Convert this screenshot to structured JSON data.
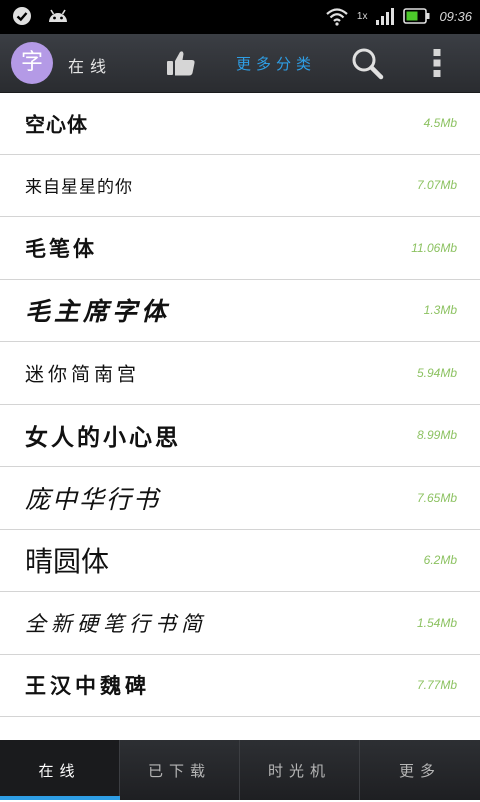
{
  "status_bar": {
    "network_label": "1x",
    "time": "09:36",
    "icons": [
      "check-circle-icon",
      "android-icon",
      "wifi-icon",
      "signal-icon",
      "battery-icon"
    ]
  },
  "app_bar": {
    "logo_char": "字",
    "online_tab": "在线",
    "more_categories": "更多分类",
    "icons": [
      "thumbs-up-icon",
      "search-icon",
      "overflow-menu-icon"
    ],
    "accent_color": "#2e9ee5"
  },
  "fonts": [
    {
      "name": "空心体",
      "size": "4.5Mb"
    },
    {
      "name": "来自星星的你",
      "size": "7.07Mb"
    },
    {
      "name": "毛笔体",
      "size": "11.06Mb"
    },
    {
      "name": "毛主席字体",
      "size": "1.3Mb"
    },
    {
      "name": "迷你简南宫",
      "size": "5.94Mb"
    },
    {
      "name": "女人的小心思",
      "size": "8.99Mb"
    },
    {
      "name": "庞中华行书",
      "size": "7.65Mb"
    },
    {
      "name": "晴圆体",
      "size": "6.2Mb"
    },
    {
      "name": "全新硬笔行书简",
      "size": "1.54Mb"
    },
    {
      "name": "王汉中魏碑",
      "size": "7.77Mb"
    }
  ],
  "size_color": "#8cc261",
  "bottom_nav": {
    "tabs": [
      "在线",
      "已下载",
      "时光机",
      "更多"
    ],
    "active_index": 0
  }
}
